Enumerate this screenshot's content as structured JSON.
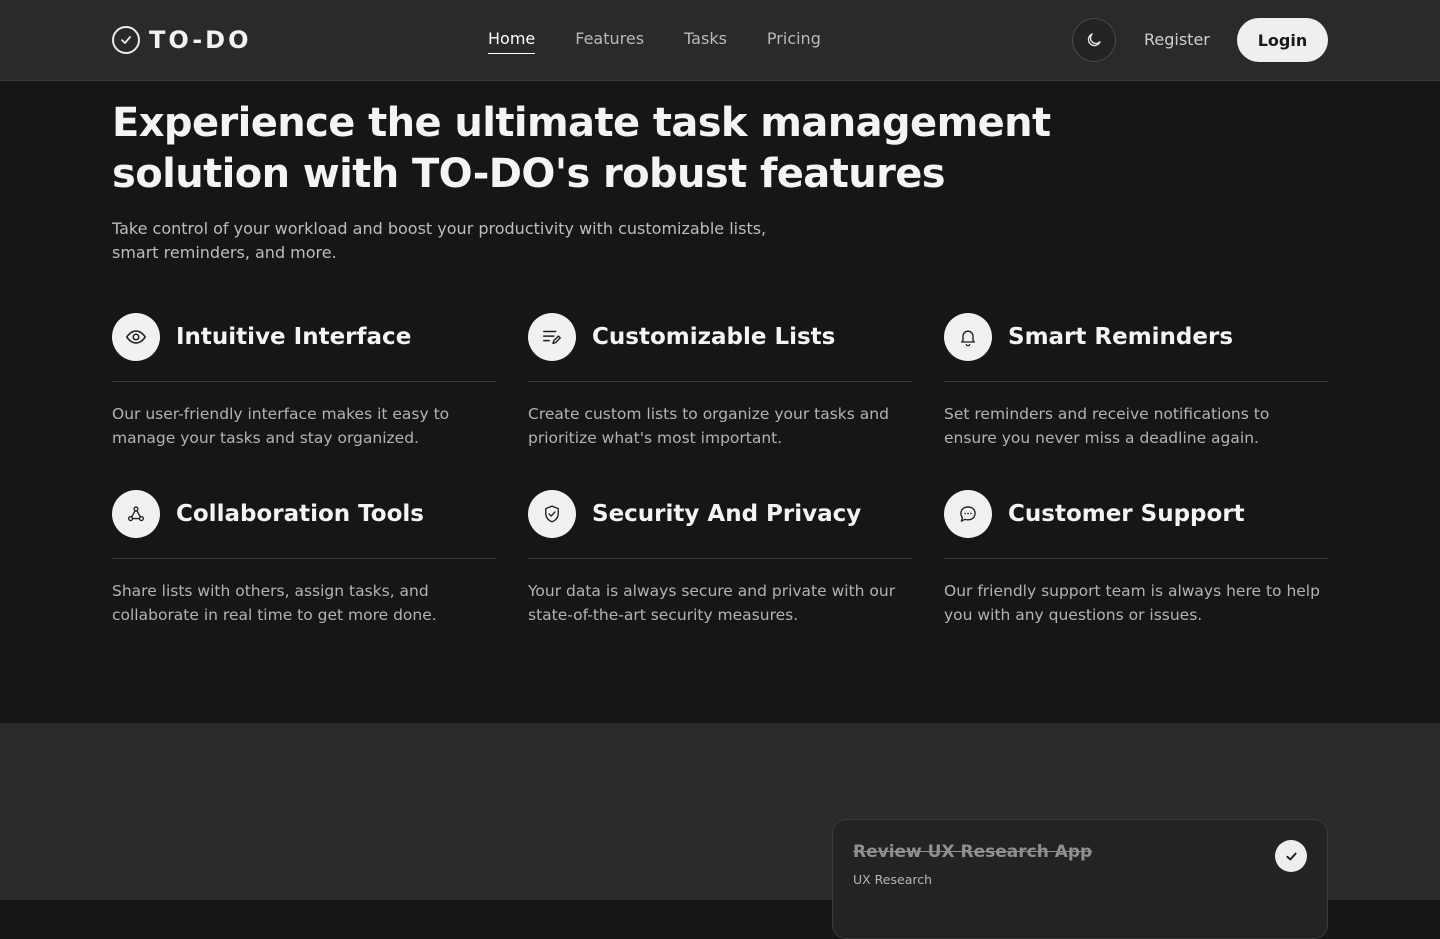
{
  "brand": {
    "name": "TO-DO",
    "icon": "check-circle-icon"
  },
  "nav": {
    "links": [
      {
        "label": "Home",
        "active": true
      },
      {
        "label": "Features",
        "active": false
      },
      {
        "label": "Tasks",
        "active": false
      },
      {
        "label": "Pricing",
        "active": false
      }
    ],
    "theme_icon": "moon-icon",
    "register_label": "Register",
    "login_label": "Login"
  },
  "hero": {
    "title_line1": "Experience the ultimate task management",
    "title_line2": "solution with TO-DO's robust features",
    "subtitle_line1": "Take control of your workload and boost your productivity with customizable lists,",
    "subtitle_line2": "smart reminders, and more."
  },
  "features": [
    {
      "icon": "eye-icon",
      "title": "Intuitive Interface",
      "desc_line1": "Our user-friendly interface makes it easy to",
      "desc_line2": "manage your tasks and stay organized."
    },
    {
      "icon": "list-edit-icon",
      "title": "Customizable Lists",
      "desc_line1": "Create custom lists to organize your tasks and",
      "desc_line2": "prioritize what's most important."
    },
    {
      "icon": "bell-icon",
      "title": "Smart Reminders",
      "desc_line1": "Set reminders and receive notifications to",
      "desc_line2": "ensure you never miss a deadline again."
    },
    {
      "icon": "share-nodes-icon",
      "title": "Collaboration Tools",
      "desc_line1": "Share lists with others, assign tasks, and",
      "desc_line2": "collaborate in real time to get more done."
    },
    {
      "icon": "shield-check-icon",
      "title": "Security And Privacy",
      "desc_line1": "Your data is always secure and private with our",
      "desc_line2": "state-of-the-art security measures."
    },
    {
      "icon": "chat-bubble-icon",
      "title": "Customer Support",
      "desc_line1": "Our friendly support team is always here to help",
      "desc_line2": "you with any questions or issues."
    }
  ],
  "task_card": {
    "title": "Review UX Research App",
    "tag": "UX Research",
    "completed": true,
    "check_icon": "check-icon"
  },
  "colors": {
    "page_bg": "#161616",
    "nav_bg": "#2a2a2a",
    "lower_bg": "#2b2b2b",
    "text_primary": "#f4f4f4",
    "text_muted": "#b3b3b3",
    "icon_circle": "#f1f1f1"
  }
}
